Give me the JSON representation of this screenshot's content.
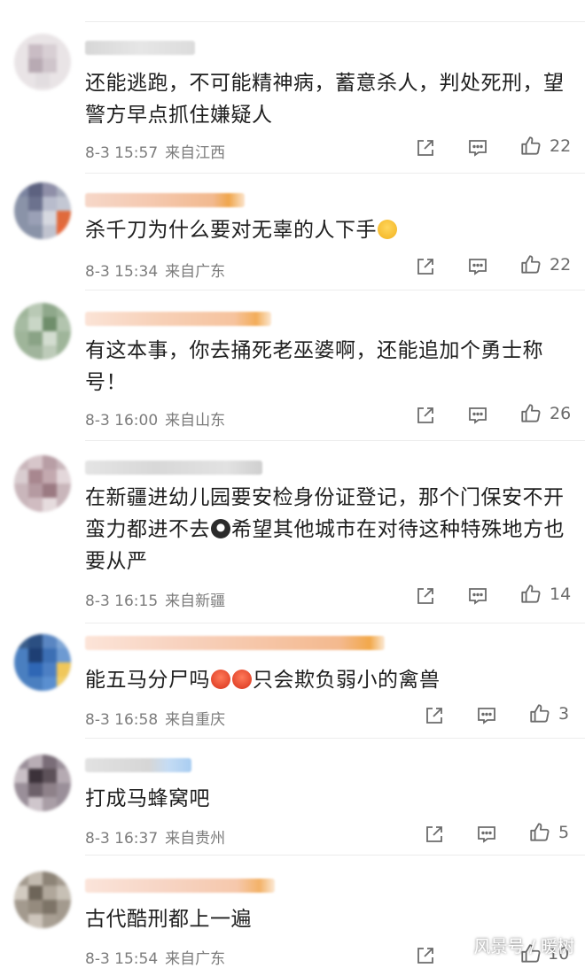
{
  "comments": [
    {
      "text": "还能逃跑，不可能精神病，蓄意杀人，判处死刑，望警方早点抓住嫌疑人",
      "time": "8-3 15:57",
      "location": "来自江西",
      "likes": "22"
    },
    {
      "text": "杀千刀为什么要对无辜的人下手",
      "emoji": "crying-face-emoji",
      "time": "8-3 15:34",
      "location": "来自广东",
      "likes": "22"
    },
    {
      "text": "有这本事，你去捅死老巫婆啊，还能追加个勇士称号！",
      "time": "8-3 16:00",
      "location": "来自山东",
      "likes": "26"
    },
    {
      "text_part1": "在新疆进幼儿园要安检身份证登记，那个门保安不开蛮力都进不去",
      "emoji": "speechless-face-emoji",
      "text_part2": "希望其他城市在对待这种特殊地方也要从严",
      "time": "8-3 16:15",
      "location": "来自新疆",
      "likes": "14"
    },
    {
      "text_part1": "能五马分尸吗",
      "emoji": "angry-face-emoji",
      "text_part2": "只会欺负弱小的禽兽",
      "time": "8-3 16:58",
      "location": "来自重庆",
      "likes": "3"
    },
    {
      "text": "打成马蜂窝吧",
      "time": "8-3 16:37",
      "location": "来自贵州",
      "likes": "5"
    },
    {
      "text": "古代酷刑都上一遍",
      "time": "8-3 15:54",
      "location": "来自广东",
      "likes": "10"
    }
  ],
  "watermark": "风景号 / 暖树",
  "colors": {
    "meta": "#7c7c7c",
    "icon": "#6b6b6b",
    "separator": "#ececec"
  },
  "icons": {
    "share": "share-icon",
    "comment": "comment-icon",
    "like": "thumbs-up-icon"
  }
}
